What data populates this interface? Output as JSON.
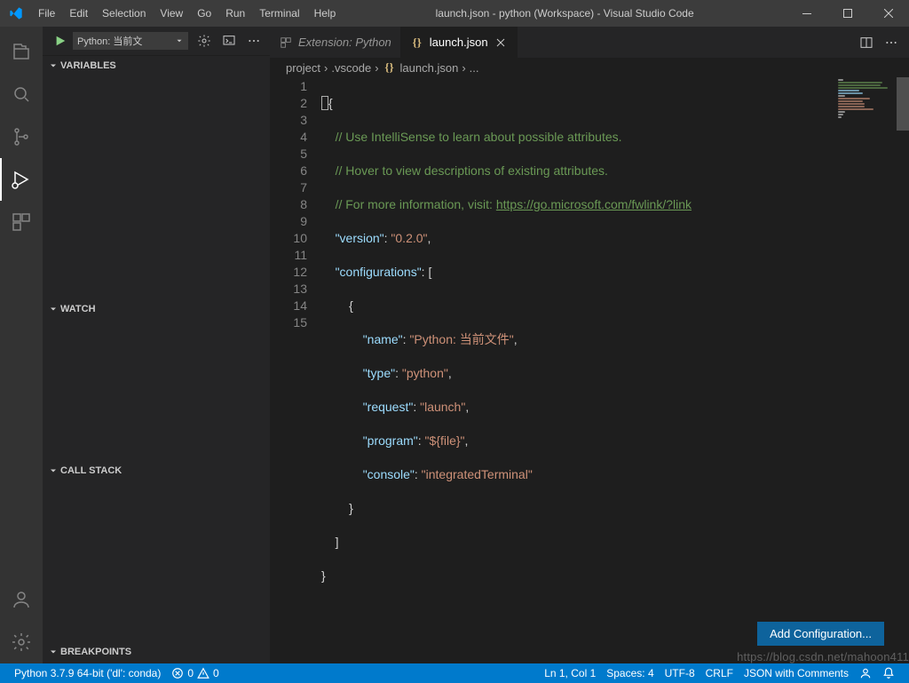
{
  "titlebar": {
    "title": "launch.json - python (Workspace) - Visual Studio Code",
    "menu": [
      "File",
      "Edit",
      "Selection",
      "View",
      "Go",
      "Run",
      "Terminal",
      "Help"
    ]
  },
  "sidebar": {
    "config_label": "Python: 当前文",
    "sections": {
      "variables": "VARIABLES",
      "watch": "WATCH",
      "callstack": "CALL STACK",
      "breakpoints": "BREAKPOINTS"
    }
  },
  "tabs": {
    "ext_python": "Extension: Python",
    "launch_json": "launch.json"
  },
  "breadcrumb": {
    "p0": "project",
    "p1": ".vscode",
    "p2": "launch.json",
    "p3": "..."
  },
  "code": {
    "c1": "// Use IntelliSense to learn about possible attributes.",
    "c2": "// Hover to view descriptions of existing attributes.",
    "c3a": "// For more information, visit: ",
    "c3b": "https://go.microsoft.com/fwlink/?link",
    "k_version": "\"version\"",
    "v_version": "\"0.2.0\"",
    "k_configs": "\"configurations\"",
    "k_name": "\"name\"",
    "v_name": "\"Python: 当前文件\"",
    "k_type": "\"type\"",
    "v_type": "\"python\"",
    "k_request": "\"request\"",
    "v_request": "\"launch\"",
    "k_program": "\"program\"",
    "v_program": "\"${file}\"",
    "k_console": "\"console\"",
    "v_console": "\"integratedTerminal\""
  },
  "lines": [
    "1",
    "2",
    "3",
    "4",
    "5",
    "6",
    "7",
    "8",
    "9",
    "10",
    "11",
    "12",
    "13",
    "14",
    "15"
  ],
  "button": {
    "add_config": "Add Configuration..."
  },
  "status": {
    "python": "Python 3.7.9 64-bit ('dl': conda)",
    "errors": "0",
    "warnings": "0",
    "ln": "Ln 1, Col 1",
    "spaces": "Spaces: 4",
    "encoding": "UTF-8",
    "eol": "CRLF",
    "lang": "JSON with Comments"
  },
  "watermark": "https://blog.csdn.net/mahoon411"
}
